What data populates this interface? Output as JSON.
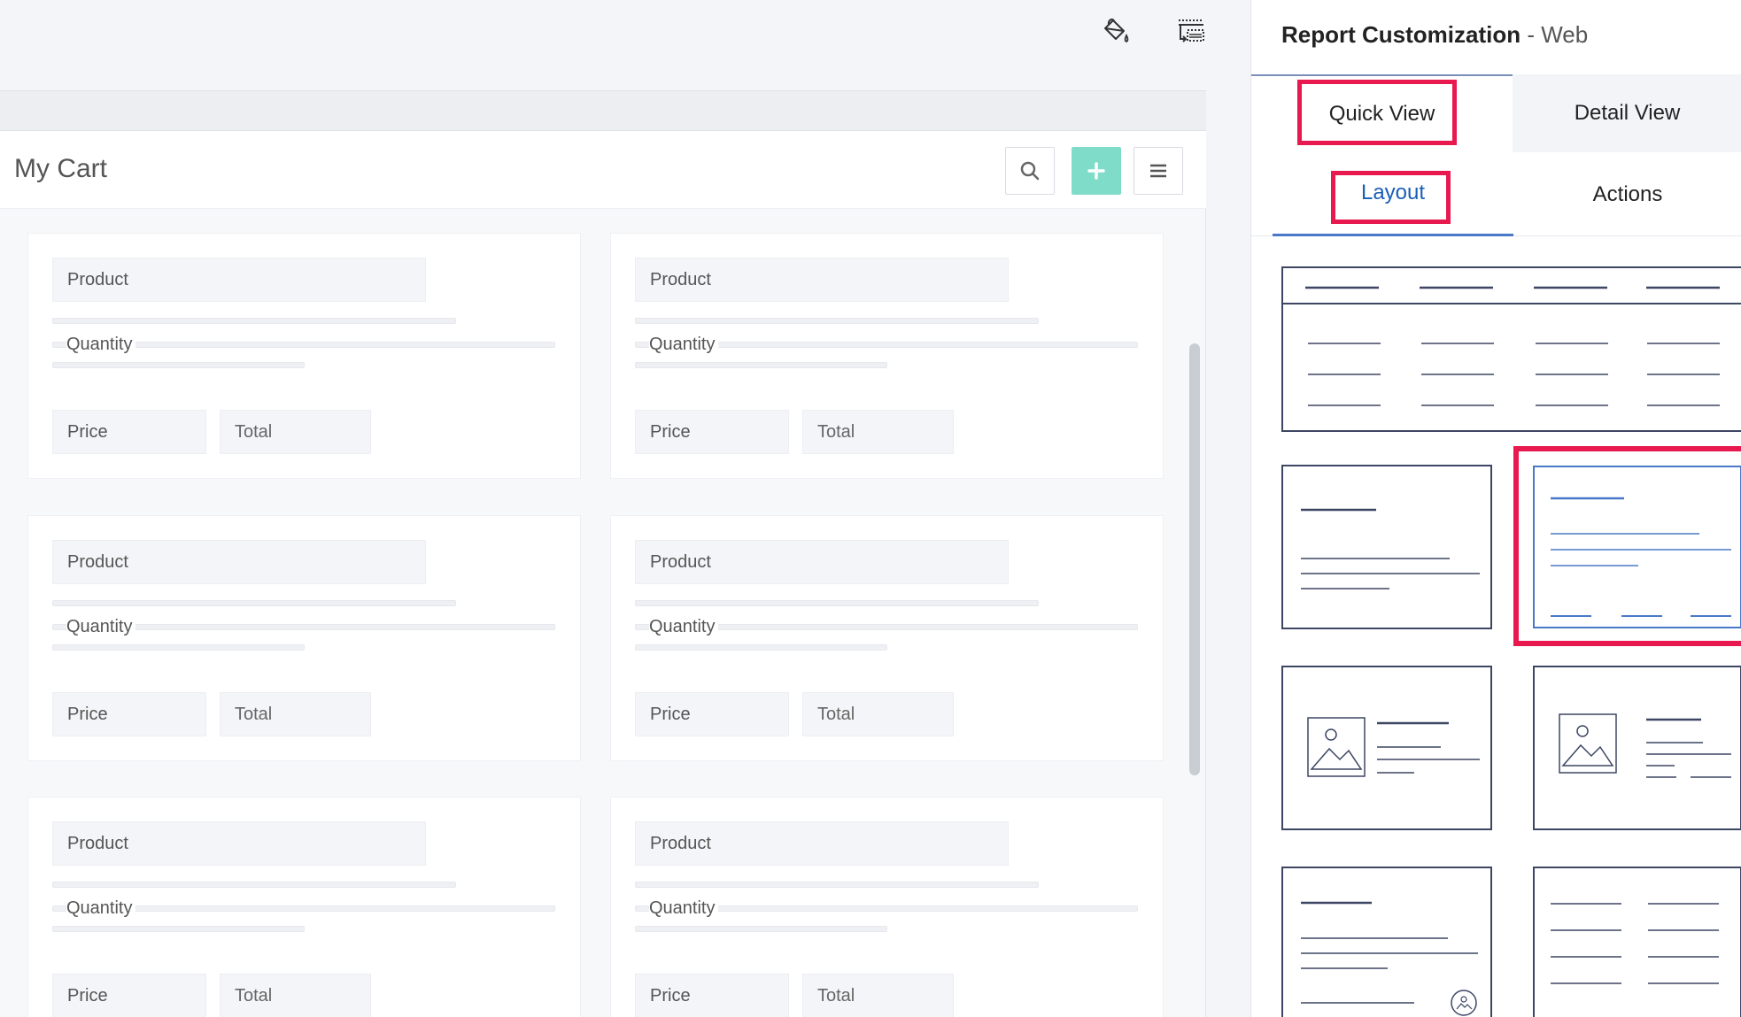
{
  "app": {
    "report_title": "My Cart",
    "colors": {
      "accent": "#7fdcc9",
      "highlight": "#e8194f",
      "link": "#1a5fb4"
    },
    "icons": {
      "paint": "paint-bucket-icon",
      "layout": "layout-toggle-icon",
      "search": "search-icon",
      "add": "plus-icon",
      "menu": "hamburger-icon"
    }
  },
  "cards": [
    {
      "product": "Product",
      "quantity": "Quantity",
      "price": "Price",
      "total": "Total"
    },
    {
      "product": "Product",
      "quantity": "Quantity",
      "price": "Price",
      "total": "Total"
    },
    {
      "product": "Product",
      "quantity": "Quantity",
      "price": "Price",
      "total": "Total"
    },
    {
      "product": "Product",
      "quantity": "Quantity",
      "price": "Price",
      "total": "Total"
    },
    {
      "product": "Product",
      "quantity": "Quantity",
      "price": "Price",
      "total": "Total"
    },
    {
      "product": "Product",
      "quantity": "Quantity",
      "price": "Price",
      "total": "Total"
    }
  ],
  "panel": {
    "title": "Report Customization",
    "title_sep": " - ",
    "title_sub": "Web",
    "tabs": [
      {
        "label": "Quick View"
      },
      {
        "label": "Detail View"
      }
    ],
    "subtabs": [
      {
        "label": "Layout"
      },
      {
        "label": "Actions"
      }
    ],
    "active_tab": "Quick View",
    "active_subtab": "Layout"
  }
}
